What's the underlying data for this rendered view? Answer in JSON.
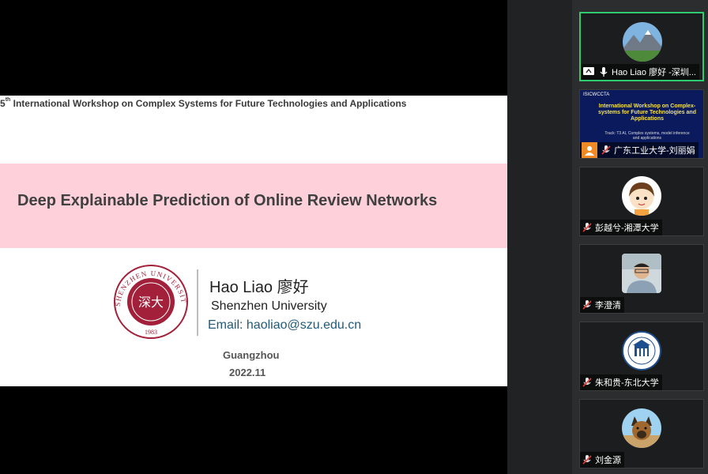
{
  "slide": {
    "workshop_num": "5",
    "workshop_sup": "th",
    "workshop_rest": " International Workshop on Complex Systems for Future Technologies and Applications",
    "title": "Deep Explainable Prediction of Online Review Networks",
    "author": "Hao Liao 廖好",
    "affiliation": "Shenzhen University",
    "email": "Email: haoliao@szu.edu.cn",
    "city": "Guangzhou",
    "date": "2022.11",
    "logo": {
      "arc_text": "SHENZHEN UNIVERSITY",
      "year": "1983",
      "center": "深大",
      "color": "#a3203a"
    }
  },
  "participants": [
    {
      "name": "Hao Liao 廖好 -深圳...",
      "avatar": "mountain-photo",
      "active": true
    },
    {
      "name": "广东工业大学-刘丽娟",
      "avatar": "screen-share",
      "active": false,
      "thumb": {
        "logo": "ISICWCCTA",
        "title": "International Workshop on Complex-systems for Future Technologies and Applications",
        "sub": "Track: T3 AI, Complex systems, model inference and applications"
      }
    },
    {
      "name": "彭越兮-湘潭大学",
      "avatar": "cartoon-boy",
      "active": false
    },
    {
      "name": "李澄清",
      "avatar": "person-photo",
      "active": false
    },
    {
      "name": "朱和贵-东北大学",
      "avatar": "university-emblem",
      "active": false
    },
    {
      "name": "刘金源",
      "avatar": "dog-photo",
      "active": false
    }
  ],
  "colors": {
    "active_border": "#2ecc71",
    "band": "#fdd0da",
    "muted_mic": "#e8e8e8",
    "mute_slash": "#e53935"
  }
}
